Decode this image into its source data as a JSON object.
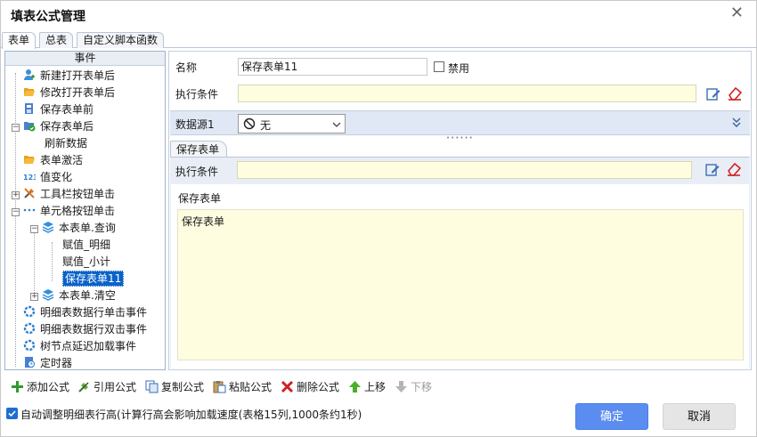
{
  "window": {
    "title": "填表公式管理",
    "close_glyph": "✕"
  },
  "tabs": [
    {
      "label": "表单"
    },
    {
      "label": "总表"
    },
    {
      "label": "自定义脚本函数"
    }
  ],
  "tree": {
    "header": "事件",
    "items": [
      {
        "label": "新建打开表单后",
        "icon": "user-plus-icon"
      },
      {
        "label": "修改打开表单后",
        "icon": "folder-open-icon"
      },
      {
        "label": "保存表单前",
        "icon": "document-save-icon"
      },
      {
        "label": "保存表单后",
        "icon": "folder-check-icon",
        "expanded": true
      },
      {
        "label": "刷新数据"
      },
      {
        "label": "表单激活",
        "icon": "folder-open-icon"
      },
      {
        "label": "值变化",
        "icon": "numbers-123-icon"
      },
      {
        "label": "工具栏按钮单击",
        "icon": "tools-icon",
        "expanded": false
      },
      {
        "label": "单元格按钮单击",
        "icon": "dots-icon",
        "expanded": true
      },
      {
        "label": "本表单.查询",
        "icon": "layers-icon",
        "expanded": true
      },
      {
        "label": "赋值_明细"
      },
      {
        "label": "赋值_小计"
      },
      {
        "label": "保存表单11",
        "selected": true
      },
      {
        "label": "本表单.清空",
        "icon": "layers-icon",
        "expanded": false
      },
      {
        "label": "明细表数据行单击事件",
        "icon": "ring-icon"
      },
      {
        "label": "明细表数据行双击事件",
        "icon": "ring-icon"
      },
      {
        "label": "树节点延迟加载事件",
        "icon": "ring-icon"
      },
      {
        "label": "定时器",
        "icon": "timer-icon"
      }
    ]
  },
  "form": {
    "name_label": "名称",
    "name_value": "保存表单11",
    "disable_label": "禁用",
    "disabled": false,
    "condition_label": "执行条件",
    "condition_value": "",
    "datasource_label": "数据源1",
    "datasource_value": "无",
    "subtab_label": "保存表单",
    "sub_condition_label": "执行条件",
    "sub_condition_value": "",
    "section_label": "保存表单",
    "script_text": "保存表单"
  },
  "toolbar": {
    "items": [
      {
        "label": "添加公式",
        "icon": "plus-icon",
        "color": "#2f9a2f"
      },
      {
        "label": "引用公式",
        "icon": "link-icon",
        "color": "#3e7d2d"
      },
      {
        "label": "复制公式",
        "icon": "copy-icon",
        "color": "#3a6fb5"
      },
      {
        "label": "粘贴公式",
        "icon": "paste-icon",
        "color": "#8a6a2e"
      },
      {
        "label": "删除公式",
        "icon": "delete-x-icon",
        "color": "#d02020"
      },
      {
        "label": "上移",
        "icon": "arrow-up-icon",
        "color": "#4caf2a"
      },
      {
        "label": "下移",
        "icon": "arrow-down-icon",
        "color": "#9a9a9a",
        "disabled": true
      }
    ]
  },
  "footer": {
    "auto_height_checked": true,
    "auto_height_label": "自动调整明细表行高(计算行高会影响加载速度(表格15列,1000条约1秒)",
    "ok_label": "确定",
    "cancel_label": "取消"
  },
  "colors": {
    "accent": "#5b8df0",
    "selection": "#0a63c9",
    "condition_bg": "#fffde0",
    "datasource_bar": "#dfe8f4"
  }
}
